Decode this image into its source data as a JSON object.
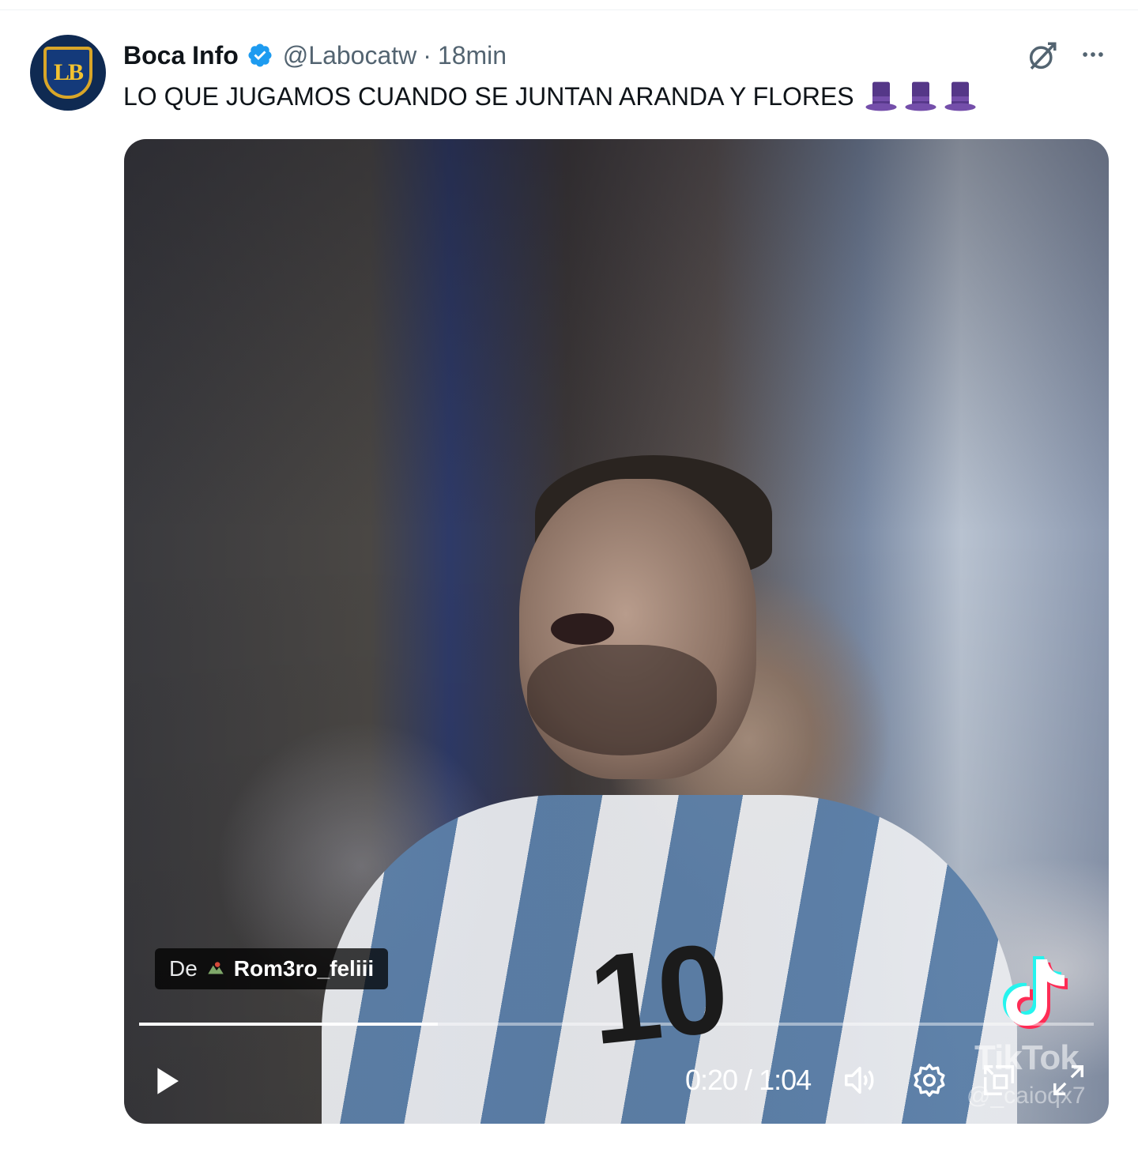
{
  "tweet": {
    "author_name": "Boca Info",
    "handle": "@Labocatw",
    "separator": "·",
    "time": "18min",
    "text": "LO QUE JUGAMOS CUANDO SE JUNTAN ARANDA Y FLORES",
    "emoji": [
      "top-hat-emoji",
      "top-hat-emoji",
      "top-hat-emoji"
    ],
    "avatar_letters": "LB",
    "verified": true
  },
  "video": {
    "source_prefix": "De",
    "source_user": "Rom3ro_feliii",
    "watermark_brand": "TikTok",
    "watermark_user": "@_caioqx7",
    "current_time": "0:20",
    "duration": "1:04",
    "time_display": "0:20 / 1:04",
    "progress": 0.3125,
    "controls": [
      "play-icon",
      "volume-icon",
      "settings-icon",
      "pip-icon",
      "fullscreen-icon"
    ]
  },
  "colors": {
    "verified_blue": "#1d9bf0",
    "text_primary": "#0f1419",
    "text_secondary": "#536471",
    "hat_purple": "#8e5ac4"
  }
}
